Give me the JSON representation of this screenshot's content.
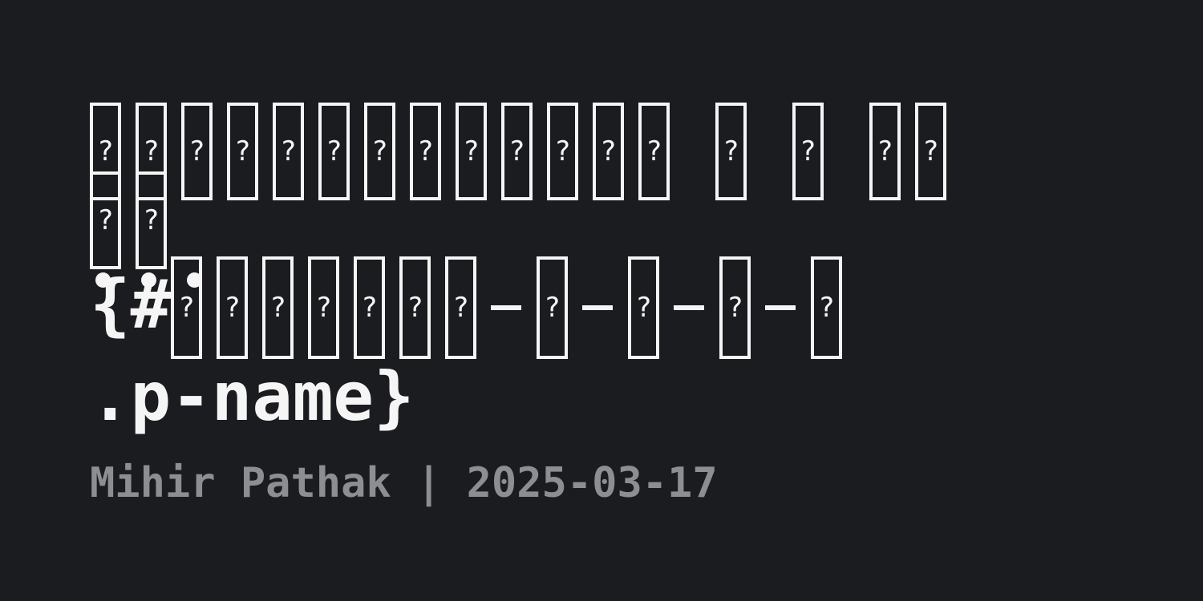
{
  "title": {
    "line1_glyph_count": 17,
    "line3_prefix": "{#",
    "line4_text": ".p-name}"
  },
  "meta": {
    "text": "Mihir Pathak | 2025-03-17"
  },
  "colors": {
    "background": "#1b1c20",
    "title": "#f5f5f5",
    "meta": "#8d8e92"
  }
}
